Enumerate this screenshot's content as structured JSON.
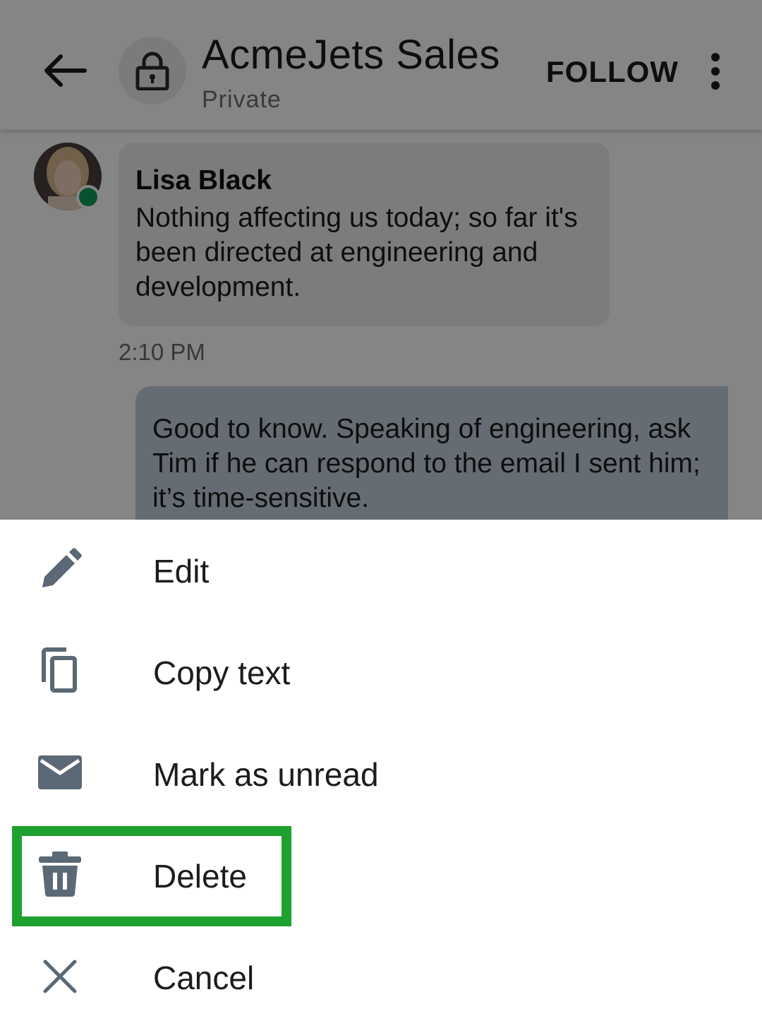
{
  "header": {
    "title": "AcmeJets Sales",
    "subtitle": "Private",
    "follow_label": "FOLLOW"
  },
  "messages": [
    {
      "sender": "Lisa Black",
      "text": "Nothing affecting us today; so far it's been directed at engineering and development.",
      "time": "2:10 PM"
    },
    {
      "text": "Good to know. Speaking of engineering, ask Tim if he can respond to the email I sent him; it’s time-sensitive."
    }
  ],
  "menu": {
    "items": [
      {
        "label": "Edit",
        "icon": "pencil-icon"
      },
      {
        "label": "Copy text",
        "icon": "copy-icon"
      },
      {
        "label": "Mark as unread",
        "icon": "envelope-icon"
      },
      {
        "label": "Delete",
        "icon": "trash-icon"
      },
      {
        "label": "Cancel",
        "icon": "close-icon"
      }
    ]
  },
  "colors": {
    "icon": "#5b6875",
    "highlight": "#1ea12f",
    "online": "#0f9d58",
    "own_bubble": "#c3d0de"
  }
}
